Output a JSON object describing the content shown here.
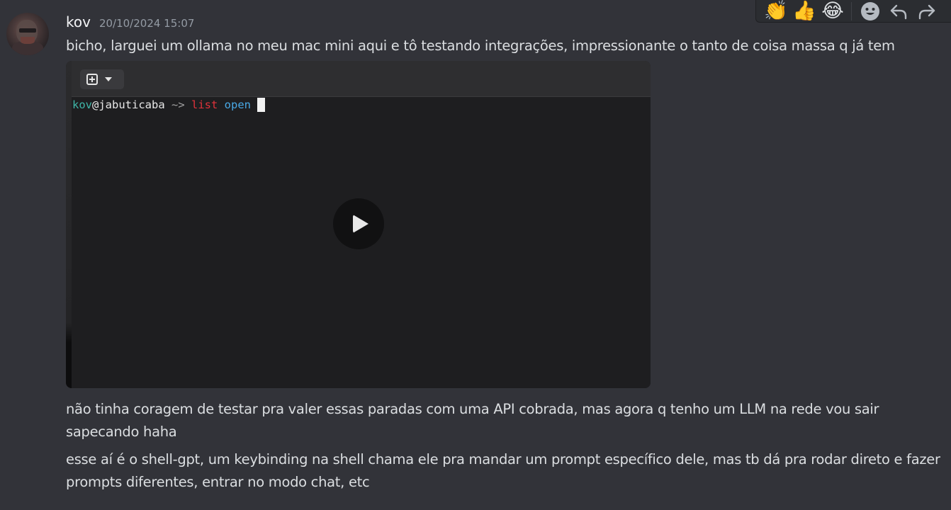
{
  "message": {
    "author": "kov",
    "timestamp": "20/10/2024 15:07",
    "lines": [
      "bicho, larguei um ollama no meu mac mini aqui e tô testando integrações, impressionante o tanto de coisa massa q já tem",
      "não tinha coragem de testar pra valer essas paradas com uma API cobrada, mas agora q tenho um LLM na rede vou sair sapecando haha",
      "esse aí é o shell-gpt, um keybinding na shell chama ele pra mandar um prompt específico dele, mas tb dá pra rodar direto e fazer prompts diferentes, entrar no modo chat, etc"
    ]
  },
  "toolbar": {
    "reactions": [
      {
        "emoji": "👏",
        "icon": "clapping-hands-icon"
      },
      {
        "emoji": "👍",
        "icon": "thumbs-up-icon"
      },
      {
        "emoji": "😂",
        "icon": "tears-of-joy-icon"
      }
    ],
    "actions": [
      {
        "icon": "add-reaction-icon"
      },
      {
        "icon": "reply-icon"
      },
      {
        "icon": "forward-icon"
      }
    ]
  },
  "video": {
    "terminal": {
      "user": "kov",
      "host": "@jabuticaba",
      "arrow": " ~> ",
      "command": "list",
      "argument": "open"
    },
    "play_icon": "play-icon"
  }
}
